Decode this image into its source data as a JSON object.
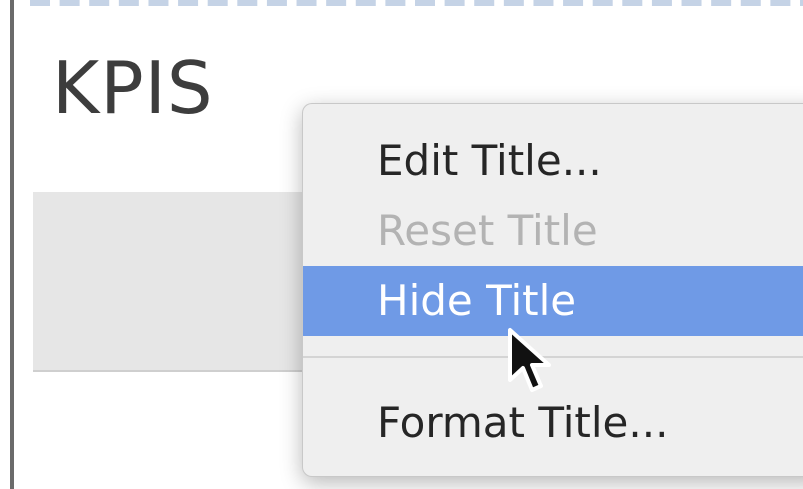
{
  "page": {
    "title": "KPIS"
  },
  "context_menu": {
    "items": [
      {
        "label": "Edit Title...",
        "state": "enabled"
      },
      {
        "label": "Reset Title",
        "state": "disabled"
      },
      {
        "label": "Hide Title",
        "state": "highlighted"
      },
      {
        "label": "Format Title...",
        "state": "enabled"
      }
    ]
  },
  "colors": {
    "highlight": "#6f9ae6",
    "menu_background": "#efefef",
    "disabled_text": "#b3b3b3",
    "dashed_border": "#c5d3e6"
  },
  "icons": {
    "cursor": "arrow-pointer-icon"
  }
}
